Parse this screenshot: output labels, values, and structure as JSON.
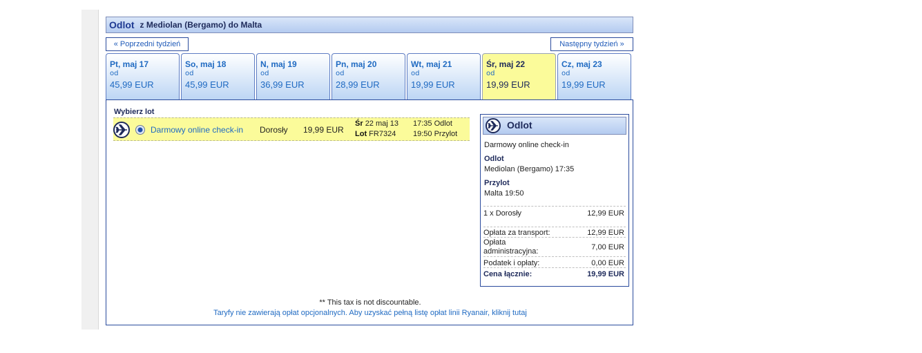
{
  "header": {
    "title": "Odlot",
    "route": "z Mediolan (Bergamo) do Malta"
  },
  "week_nav": {
    "prev_label": "« Poprzedni tydzień",
    "next_label": "Następny tydzień »"
  },
  "date_tabs": [
    {
      "day": "Pt, maj 17",
      "from": "od",
      "price": "45,99 EUR",
      "selected": false
    },
    {
      "day": "So, maj 18",
      "from": "od",
      "price": "45,99 EUR",
      "selected": false
    },
    {
      "day": "N, maj 19",
      "from": "od",
      "price": "36,99 EUR",
      "selected": false
    },
    {
      "day": "Pn, maj 20",
      "from": "od",
      "price": "28,99 EUR",
      "selected": false
    },
    {
      "day": "Wt, maj 21",
      "from": "od",
      "price": "19,99 EUR",
      "selected": false
    },
    {
      "day": "Śr, maj 22",
      "from": "od",
      "price": "19,99 EUR",
      "selected": true
    },
    {
      "day": "Cz, maj 23",
      "from": "od",
      "price": "19,99 EUR",
      "selected": false
    }
  ],
  "flight_list": {
    "label": "Wybierz lot",
    "row": {
      "fare_name": "Darmowy online check-in",
      "passenger_type": "Dorosły",
      "price": "19,99 EUR",
      "day_label": "Śr",
      "date": "22 maj 13",
      "flight_label": "Lot",
      "flight_number": "FR7324",
      "departure": "17:35 Odlot",
      "arrival": "19:50 Przylot"
    }
  },
  "summary": {
    "title": "Odlot",
    "fare_name": "Darmowy online check-in",
    "departure_label": "Odlot",
    "departure_value": "Mediolan (Bergamo) 17:35",
    "arrival_label": "Przylot",
    "arrival_value": "Malta 19:50",
    "lines": [
      {
        "label": "1 x Dorosły",
        "value": "12,99 EUR"
      },
      {
        "label": "Opłata za transport:",
        "value": "12,99 EUR"
      },
      {
        "label": "Opłata administracyjna:",
        "value": "7,00 EUR"
      },
      {
        "label": "Podatek i opłaty:",
        "value": "0,00 EUR"
      }
    ],
    "total_label": "Cena łącznie:",
    "total_value": "19,99 EUR"
  },
  "footer": {
    "footnote": "** This tax is not discountable.",
    "fees_link": "Taryfy nie zawierają opłat opcjonalnych. Aby uzyskać pełną listę opłat linii Ryanair, kliknij tutaj"
  },
  "colors": {
    "accent": "#1f6ac2",
    "selected_tab": "#fbfb9a",
    "navy": "#1e2a5a"
  }
}
